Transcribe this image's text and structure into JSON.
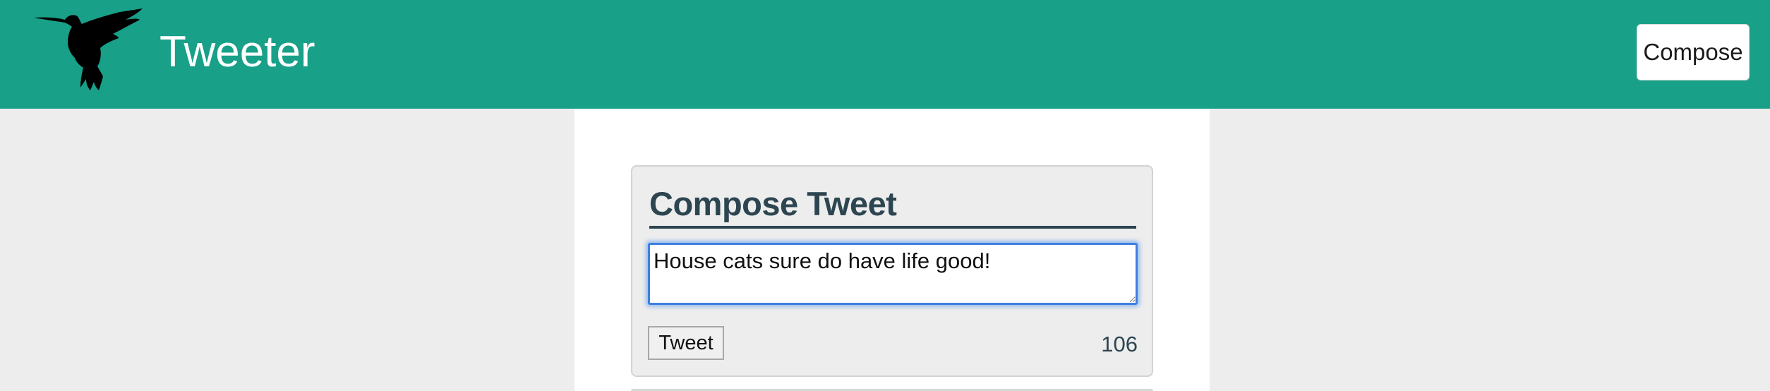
{
  "navbar": {
    "brand": "Tweeter",
    "logo_icon": "hummingbird-icon",
    "compose_label": "Compose",
    "background_color": "#18a088"
  },
  "compose": {
    "title": "Compose Tweet",
    "text_value": "House cats sure do have life good!",
    "tweet_button_label": "Tweet",
    "char_count": "106"
  },
  "colors": {
    "accent": "#18a088",
    "heading": "#2c4550",
    "focus_ring": "#3d7fe0"
  }
}
